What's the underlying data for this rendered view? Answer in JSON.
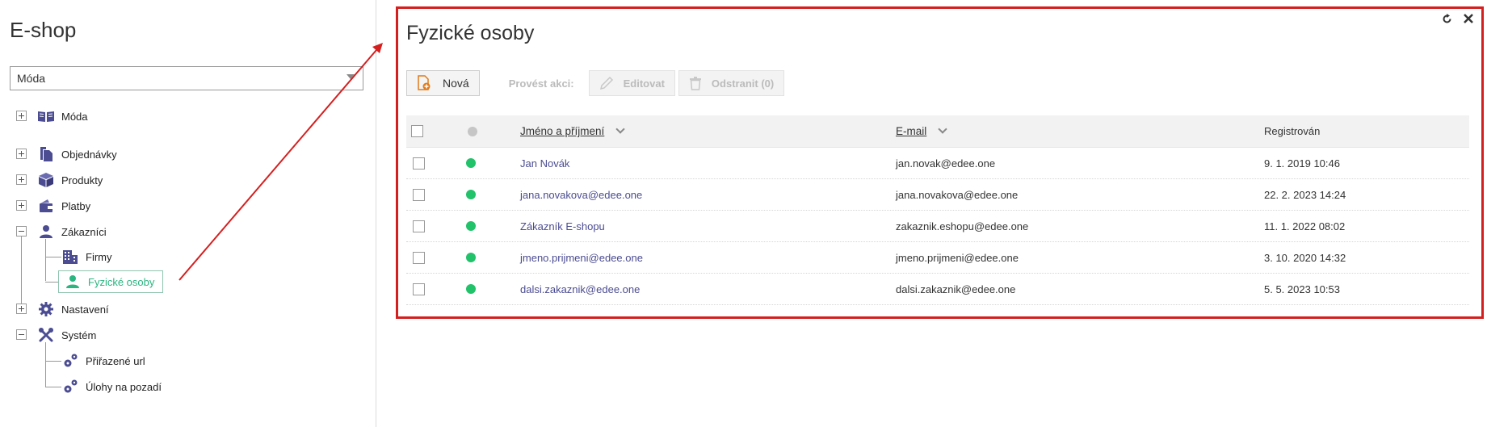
{
  "sidebar": {
    "title": "E-shop",
    "select_value": "Móda",
    "tree": {
      "moda": "Móda",
      "objednavky": "Objednávky",
      "produkty": "Produkty",
      "platby": "Platby",
      "zakaznici": "Zákazníci",
      "firmy": "Firmy",
      "fyzicke_osoby": "Fyzické osoby",
      "nastaveni": "Nastavení",
      "system": "Systém",
      "prirazene_url": "Přiřazené url",
      "ulohy_na_pozadi": "Úlohy na pozadí"
    }
  },
  "panel": {
    "title": "Fyzické osoby",
    "toolbar": {
      "new_label": "Nová",
      "action_label": "Provést akci:",
      "edit_label": "Editovat",
      "delete_label": "Odstranit (0)"
    },
    "columns": {
      "name": "Jméno a příjmení",
      "email": "E-mail",
      "registered": "Registrován"
    },
    "rows": [
      {
        "name": "Jan Novák",
        "email": "jan.novak@edee.one",
        "registered": "9. 1. 2019 10:46"
      },
      {
        "name": "jana.novakova@edee.one",
        "email": "jana.novakova@edee.one",
        "registered": "22. 2. 2023 14:24"
      },
      {
        "name": "Zákazník E-shopu",
        "email": "zakaznik.eshopu@edee.one",
        "registered": "11. 1. 2022 08:02"
      },
      {
        "name": "jmeno.prijmeni@edee.one",
        "email": "jmeno.prijmeni@edee.one",
        "registered": "3. 10. 2020 14:32"
      },
      {
        "name": "dalsi.zakaznik@edee.one",
        "email": "dalsi.zakaznik@edee.one",
        "registered": "5. 5. 2023 10:53"
      }
    ]
  },
  "colors": {
    "accent_red": "#d51f1f",
    "active_green": "#2bb580",
    "status_green": "#22c26a",
    "icon_blue": "#4b4c91",
    "link_color": "#4b4c91"
  }
}
